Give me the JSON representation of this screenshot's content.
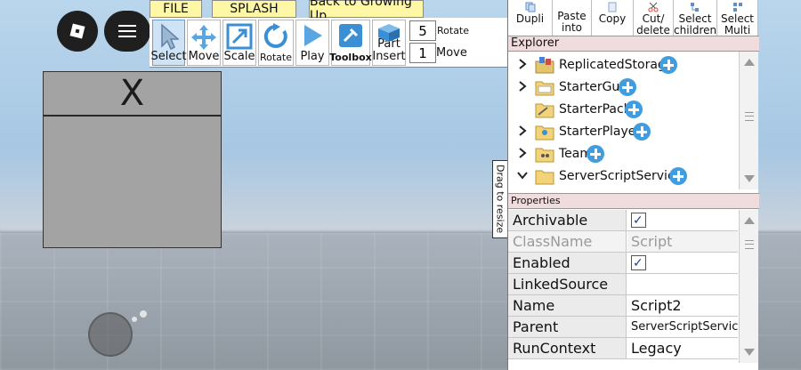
{
  "menu_tabs": {
    "file": "FILE",
    "splash": "SPLASH",
    "back": "Back to Growing Up"
  },
  "tools": {
    "select": "Select",
    "move": "Move",
    "scale": "Scale",
    "rotate": "Rotate",
    "play": "Play",
    "toolbox": "Toolbox",
    "part_insert": "Part Insert",
    "rotate_step": "5",
    "rotate_label": "Rotate",
    "move_step": "1",
    "move_label": "Move"
  },
  "gui_panel": {
    "close_label": "X"
  },
  "drag_handle": "Drag to resize",
  "explorer_buttons": {
    "dupli": "Dupli",
    "paste": "Paste into",
    "copy": "Copy",
    "cut": "Cut/ delete",
    "select_children": "Select children",
    "select_multi": "Select Multi"
  },
  "explorer": {
    "title": "Explorer",
    "items": [
      {
        "label": "ReplicatedStorage",
        "icon": "replicated-storage-icon",
        "expanded": false
      },
      {
        "label": "StarterGui",
        "icon": "folder-icon",
        "expanded": false
      },
      {
        "label": "StarterPack",
        "icon": "folder-icon",
        "expanded": null
      },
      {
        "label": "StarterPlayer",
        "icon": "folder-icon",
        "expanded": false
      },
      {
        "label": "Teams",
        "icon": "folder-icon",
        "expanded": false
      },
      {
        "label": "ServerScriptService",
        "icon": "folder-icon",
        "expanded": true
      }
    ]
  },
  "properties": {
    "title": "Properties",
    "rows": [
      {
        "name": "Archivable",
        "value": "",
        "checkbox": true
      },
      {
        "name": "ClassName",
        "value": "Script",
        "disabled": true
      },
      {
        "name": "Enabled",
        "value": "",
        "checkbox": true
      },
      {
        "name": "LinkedSource",
        "value": ""
      },
      {
        "name": "Name",
        "value": "Script2"
      },
      {
        "name": "Parent",
        "value": "ServerScriptService"
      },
      {
        "name": "RunContext",
        "value": "Legacy",
        "dropdown": true
      }
    ]
  },
  "colors": {
    "tab_yellow": "#fdf7a6",
    "header_pink": "#f0dcdc",
    "plus_blue": "#3f9de0"
  }
}
